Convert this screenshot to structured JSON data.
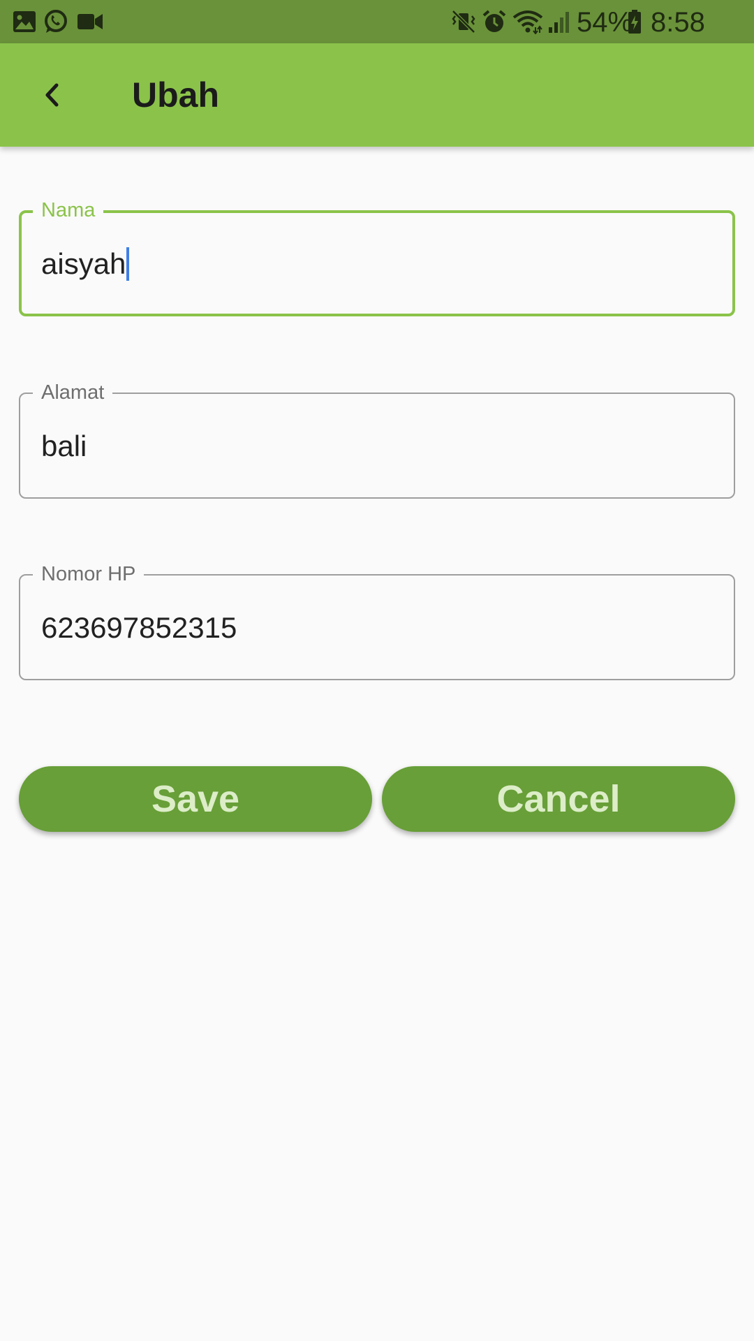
{
  "status_bar": {
    "battery_percent": "54%",
    "time": "8:58 PM",
    "left_icons": [
      "gallery-icon",
      "whatsapp-icon",
      "video-camera-icon"
    ],
    "right_icons": [
      "vibrate-mute-icon",
      "alarm-icon",
      "wifi-icon",
      "signal-icon",
      "battery-charging-icon"
    ]
  },
  "app_bar": {
    "title": "Ubah",
    "back_icon": "chevron-left-icon"
  },
  "form": {
    "nama": {
      "label": "Nama",
      "value": "aisyah",
      "focused": true
    },
    "alamat": {
      "label": "Alamat",
      "value": "bali"
    },
    "nomor_hp": {
      "label": "Nomor HP",
      "value": "623697852315"
    }
  },
  "buttons": {
    "save_label": "Save",
    "cancel_label": "Cancel"
  },
  "colors": {
    "status_bar": "#6a923a",
    "app_bar": "#8bc34a",
    "focus_border": "#8bc34a",
    "button_bg": "#689f38",
    "button_text": "#dcedc8",
    "caret": "#3f7fe6",
    "background": "#fafafa"
  }
}
